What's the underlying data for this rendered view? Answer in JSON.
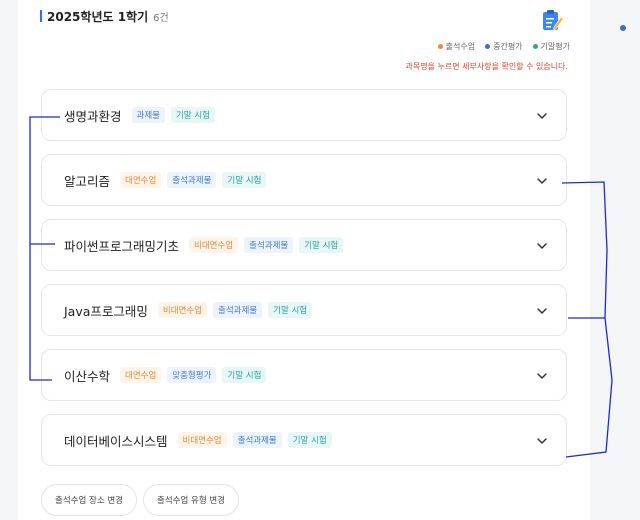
{
  "header": {
    "title": "2025학년도 1학기",
    "count": "6건"
  },
  "legend": [
    {
      "label": "출석수업",
      "color": "#ef8a3a"
    },
    {
      "label": "중간평가",
      "color": "#2f6fe0"
    },
    {
      "label": "기말평가",
      "color": "#28a89f"
    }
  ],
  "hint": "과목명을 누르면 세부사항을 확인할 수 있습니다.",
  "courses": [
    {
      "name": "생명과환경",
      "tags": [
        {
          "label": "과제물",
          "color": "blue"
        },
        {
          "label": "기말 시험",
          "color": "teal"
        }
      ]
    },
    {
      "name": "알고리즘",
      "tags": [
        {
          "label": "대면수업",
          "color": "orange"
        },
        {
          "label": "출석과제물",
          "color": "blue"
        },
        {
          "label": "기말 시험",
          "color": "teal"
        }
      ]
    },
    {
      "name": "파이썬프로그래밍기초",
      "tags": [
        {
          "label": "비대면수업",
          "color": "orange"
        },
        {
          "label": "출석과제물",
          "color": "blue"
        },
        {
          "label": "기말 시험",
          "color": "teal"
        }
      ]
    },
    {
      "name": "Java프로그래밍",
      "tags": [
        {
          "label": "비대면수업",
          "color": "orange"
        },
        {
          "label": "출석과제물",
          "color": "blue"
        },
        {
          "label": "기말 시험",
          "color": "teal"
        }
      ]
    },
    {
      "name": "이산수학",
      "tags": [
        {
          "label": "대면수업",
          "color": "orange"
        },
        {
          "label": "맞춤형평가",
          "color": "blue"
        },
        {
          "label": "기말 시험",
          "color": "teal"
        }
      ]
    },
    {
      "name": "데이터베이스시스템",
      "tags": [
        {
          "label": "비대면수업",
          "color": "orange"
        },
        {
          "label": "출석과제물",
          "color": "blue"
        },
        {
          "label": "기말 시험",
          "color": "teal"
        }
      ]
    }
  ],
  "buttons": {
    "change_location": "출석수업 장소 변경",
    "change_type": "출석수업 유형 변경"
  },
  "icons": {
    "memo": "memo-edit-icon",
    "chevron": "chevron-down-icon"
  },
  "colors": {
    "accent": "#2f6fe0",
    "hint": "#e8412c",
    "annotation": "#1a2bd6"
  }
}
